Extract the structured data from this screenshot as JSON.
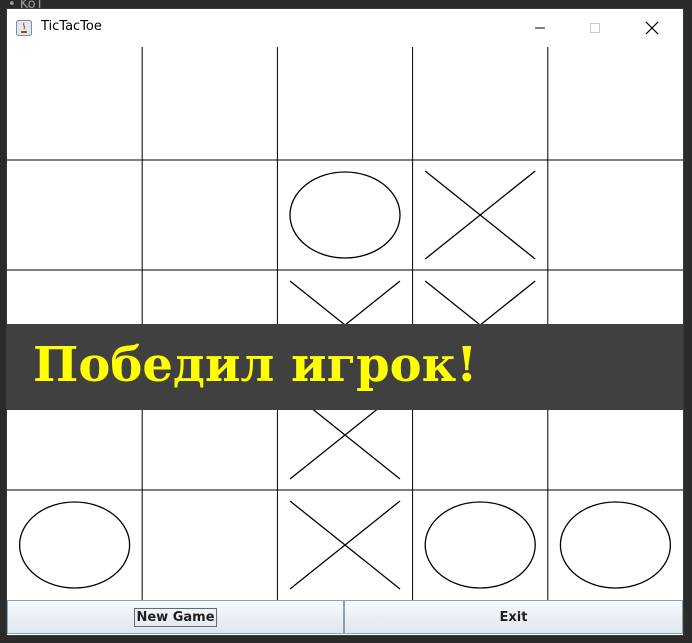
{
  "background": {
    "text": "• KoT"
  },
  "window": {
    "title": "TicTacToe"
  },
  "board": {
    "cells": [
      [
        "",
        "",
        "",
        "",
        ""
      ],
      [
        "",
        "",
        "O",
        "X",
        ""
      ],
      [
        "",
        "",
        "X",
        "X",
        ""
      ],
      [
        "",
        "",
        "X",
        "",
        ""
      ],
      [
        "O",
        "",
        "X",
        "O",
        "O"
      ]
    ]
  },
  "banner": {
    "text": "Победил игрок!",
    "color": "#ffff00",
    "background": "#404040"
  },
  "buttons": {
    "new_game": "New Game",
    "exit": "Exit"
  }
}
